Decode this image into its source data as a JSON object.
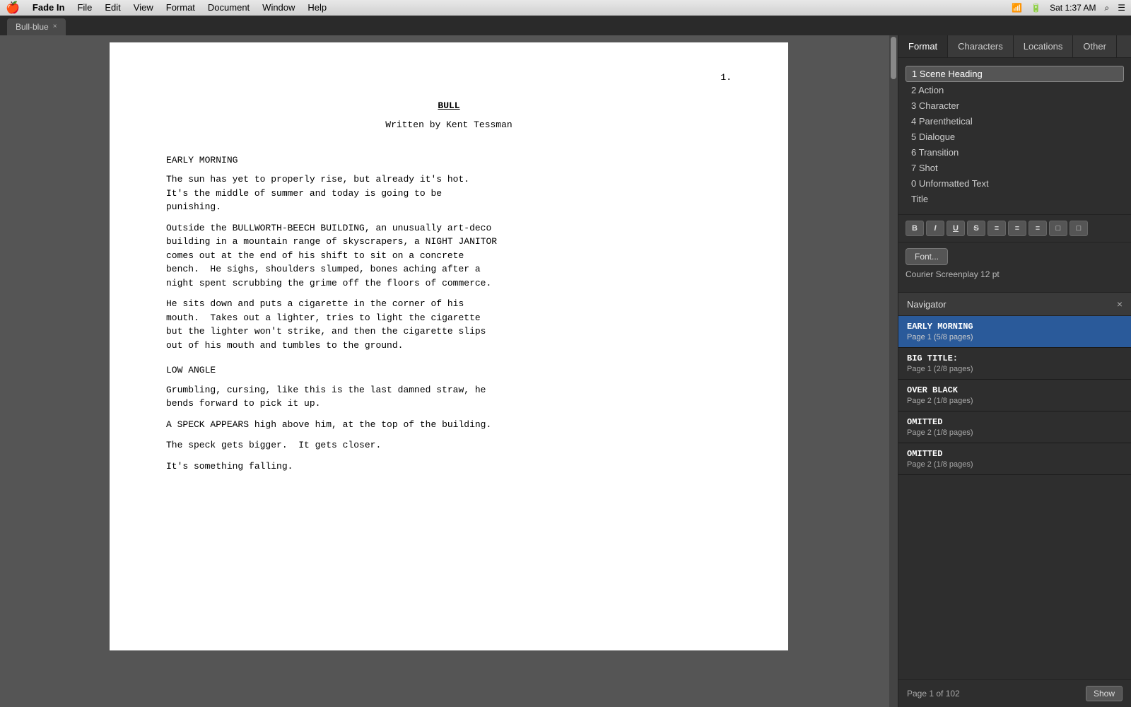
{
  "menubar": {
    "apple": "🍎",
    "app_name": "Fade In",
    "items": [
      "File",
      "Edit",
      "View",
      "Format",
      "Document",
      "Window",
      "Help"
    ],
    "time": "Sat 1:37 AM",
    "search_icon": "🔍"
  },
  "tab": {
    "label": "Bull-blue",
    "close": "×"
  },
  "format_panel": {
    "tabs": [
      "Format",
      "Characters",
      "Locations",
      "Other"
    ],
    "active_tab": "Format",
    "format_items": [
      {
        "id": "scene-heading",
        "label": "1 Scene Heading",
        "selected": true
      },
      {
        "id": "action",
        "label": "2 Action",
        "selected": false
      },
      {
        "id": "character",
        "label": "3 Character",
        "selected": false
      },
      {
        "id": "parenthetical",
        "label": "4 Parenthetical",
        "selected": false
      },
      {
        "id": "dialogue",
        "label": "5 Dialogue",
        "selected": false
      },
      {
        "id": "transition",
        "label": "6 Transition",
        "selected": false
      },
      {
        "id": "shot",
        "label": "7 Shot",
        "selected": false
      },
      {
        "id": "unformatted",
        "label": "0 Unformatted Text",
        "selected": false
      },
      {
        "id": "title",
        "label": "Title",
        "selected": false
      }
    ],
    "toolbar_buttons": [
      "B",
      "I",
      "U",
      "S",
      "≡",
      "≡",
      "≡",
      "⊞",
      "⊟"
    ],
    "font_button": "Font...",
    "font_info": "Courier Screenplay 12 pt"
  },
  "navigator": {
    "title": "Navigator",
    "items": [
      {
        "id": "early-morning",
        "title": "EARLY MORNING",
        "sub": "Page 1 (5/8 pages)",
        "active": true
      },
      {
        "id": "big-title",
        "title": "BIG TITLE:",
        "sub": "Page 1 (2/8 pages)",
        "active": false
      },
      {
        "id": "over-black",
        "title": "OVER BLACK",
        "sub": "Page 2 (1/8 pages)",
        "active": false
      },
      {
        "id": "omitted-1",
        "title": "OMITTED",
        "sub": "Page 2 (1/8 pages)",
        "active": false
      },
      {
        "id": "omitted-2",
        "title": "OMITTED",
        "sub": "Page 2 (1/8 pages)",
        "active": false
      }
    ],
    "page_info": "Page 1 of 102",
    "show_button": "Show"
  },
  "script": {
    "page_number": "1.",
    "title": "BULL",
    "byline": "Written by Kent Tessman",
    "content": [
      {
        "type": "scene",
        "text": "EARLY MORNING"
      },
      {
        "type": "action",
        "text": "The sun has yet to properly rise, but already it's hot.\nIt's the middle of summer and today is going to be\npunishing."
      },
      {
        "type": "action",
        "text": "Outside the BULLWORTH-BEECH BUILDING, an unusually art-deco\nbuilding in a mountain range of skyscrapers, a NIGHT JANITOR\ncomes out at the end of his shift to sit on a concrete\nbench.  He sighs, shoulders slumped, bones aching after a\nnight spent scrubbing the grime off the floors of commerce."
      },
      {
        "type": "action",
        "text": "He sits down and puts a cigarette in the corner of his\nmouth.  Takes out a lighter, tries to light the cigarette\nbut the lighter won't strike, and then the cigarette slips\nout of his mouth and tumbles to the ground."
      },
      {
        "type": "scene",
        "text": "LOW ANGLE"
      },
      {
        "type": "action",
        "text": "Grumbling, cursing, like this is the last damned straw, he\nbends forward to pick it up."
      },
      {
        "type": "action",
        "text": "A SPECK APPEARS high above him, at the top of the building."
      },
      {
        "type": "action",
        "text": "The speck gets bigger.  It gets closer."
      },
      {
        "type": "action",
        "text": "It's something falling."
      }
    ]
  }
}
